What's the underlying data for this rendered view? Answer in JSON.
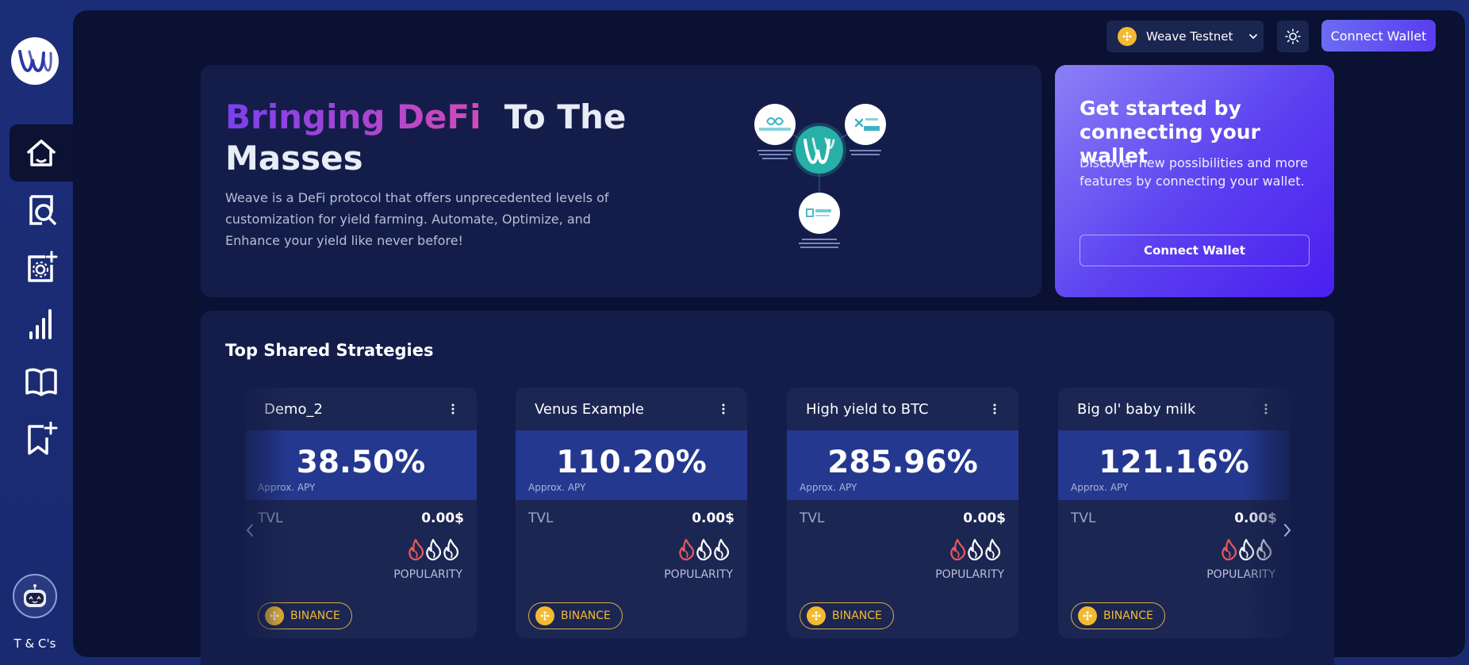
{
  "sidebar": {
    "logo_icon": "weave-logo-icon",
    "items": [
      {
        "name": "home",
        "icon": "home-icon",
        "active": true
      },
      {
        "name": "explore",
        "icon": "search-document-icon",
        "active": false
      },
      {
        "name": "create-strategy",
        "icon": "gear-add-icon",
        "active": false
      },
      {
        "name": "analytics",
        "icon": "bar-chart-icon",
        "active": false
      },
      {
        "name": "docs",
        "icon": "book-icon",
        "active": false
      },
      {
        "name": "saved",
        "icon": "bookmark-add-icon",
        "active": false
      }
    ],
    "bot_icon": "robot-icon",
    "tcs_label": "T & C's"
  },
  "header": {
    "network_label": "Weave Testnet",
    "network_icon": "bnb-icon",
    "theme_icon": "sun-icon",
    "connect_label": "Connect Wallet"
  },
  "hero": {
    "title_highlight": "Bringing DeFi",
    "title_rest": "To The Masses",
    "description": "Weave is a DeFi protocol that offers unprecedented levels of customization for yield farming. Automate, Optimize, and Enhance your yield like never before!"
  },
  "get_started": {
    "title": "Get started by connecting your wallet",
    "description": "Discover new possibilities and more features by connecting your wallet.",
    "button_label": "Connect Wallet"
  },
  "strategies": {
    "title": "Top Shared Strategies",
    "apy_label": "Approx. APY",
    "tvl_label": "TVL",
    "popularity_label": "POPULARITY",
    "cards": [
      {
        "name": "Demo_2",
        "apy": "38.50%",
        "tvl": "0.00$",
        "popularity": 1,
        "chain": "BINANCE"
      },
      {
        "name": "Venus Example",
        "apy": "110.20%",
        "tvl": "0.00$",
        "popularity": 1,
        "chain": "BINANCE"
      },
      {
        "name": "High yield to BTC",
        "apy": "285.96%",
        "tvl": "0.00$",
        "popularity": 1,
        "chain": "BINANCE"
      },
      {
        "name": "Big ol' baby milk",
        "apy": "121.16%",
        "tvl": "0.00$",
        "popularity": 1,
        "chain": "BINANCE"
      }
    ]
  },
  "colors": {
    "accent": "#5a3df0",
    "background": "#0a1133",
    "panel": "#141d4a",
    "apy_band": "#24388f",
    "binance_gold": "#f3ba2f",
    "flame_active": "#e85a5a"
  }
}
